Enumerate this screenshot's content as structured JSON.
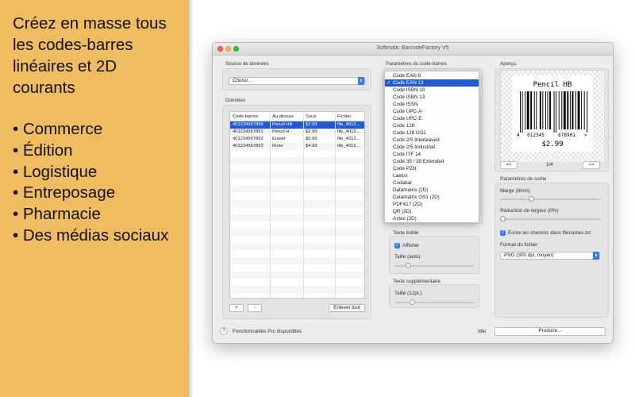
{
  "promo": {
    "headline": [
      "Créez en masse tous",
      "les codes-barres",
      "linéaires et 2D",
      "courants"
    ],
    "bullets": [
      "Commerce",
      "Édition",
      "Logistique",
      "Entreposage",
      "Pharmacie",
      "Des médias sociaux"
    ],
    "background": "#efbc5f"
  },
  "window": {
    "title": "Softmatic BarcodeFactory V5",
    "data_source": {
      "label": "Source de données",
      "select_value": "Choisir..."
    },
    "data": {
      "label": "Données",
      "columns": [
        "Code-barres",
        "Au dessus",
        "Sous",
        "Fichier"
      ],
      "rows": [
        [
          "401234567890",
          "Pencil HB",
          "$2.99",
          "file_4012..."
        ],
        [
          "401234567891",
          "Pencil H",
          "$2.99",
          "file_4012..."
        ],
        [
          "401234567892",
          "Eraser",
          "$0.99",
          "file_4012..."
        ],
        [
          "401234567893",
          "Ruler",
          "$4.99",
          "file_4012..."
        ]
      ],
      "selected_row": 0,
      "add_label": "+",
      "remove_label": "-",
      "remove_all_label": "Enlever tout"
    },
    "barcode_params": {
      "label": "Paramètres du code-barres",
      "menu_items": [
        "Code EAN 8",
        "Code EAN 13",
        "Code ISBN 10",
        "Code ISBN 13",
        "Code ISSN",
        "Code UPC-A",
        "Code UPC-E",
        "Code 128",
        "Code 128 GS1",
        "Code 2/5 Interleaved",
        "Code 2/5 Industrial",
        "Code ITF 14",
        "Code 39 / 39 Extended",
        "Code PZN",
        "Laetus",
        "Codabar",
        "Datamatrix (2D)",
        "Datamatrix GS1 (2D)",
        "PDF417 (2D)",
        "QR (2D)",
        "Aztec (2D)"
      ],
      "selected_index": 1,
      "check": "✓"
    },
    "readable_text": {
      "label": "Texte lisible",
      "show_label": "Afficher",
      "show_checked": true,
      "size_label": "Taille (auto)",
      "size_level": 0.15
    },
    "extra_text": {
      "label": "Texte supplémentaire",
      "size_label": "Taille (12pt.)",
      "size_level": 0.2
    },
    "preview": {
      "label": "Aperçu",
      "top_text": "Pencil HB",
      "digits_left": "4",
      "digits_mid1": "012345",
      "digits_mid2": "678901",
      "digits_right": ">",
      "bottom_text": "$2.99",
      "prev_label": "<<",
      "page_label": "1/4",
      "next_label": ">>"
    },
    "output": {
      "label": "Paramètres de sortie",
      "margin_label": "Marge (8mm)",
      "margin_level": 0.3,
      "width_reduction_label": "Réduction de largeur (0%)",
      "width_reduction_level": 0.0,
      "write_paths_label": "Écrire les chemins dans filenames.txt",
      "write_paths_checked": true,
      "format_label": "Format du fichier",
      "format_value": "PNG (300 dpi, moyen)"
    },
    "footer": {
      "help_label": "?",
      "pro_label": "Fonctionnalités Pro disponibles",
      "status": "Idle",
      "produce_label": "Produire..."
    }
  },
  "colors": {
    "selection": "#1f5bd6",
    "accent": "#2f7cf6",
    "close": "#fd5f57",
    "minimize": "#fdbb2e",
    "maximize": "#28c840"
  }
}
